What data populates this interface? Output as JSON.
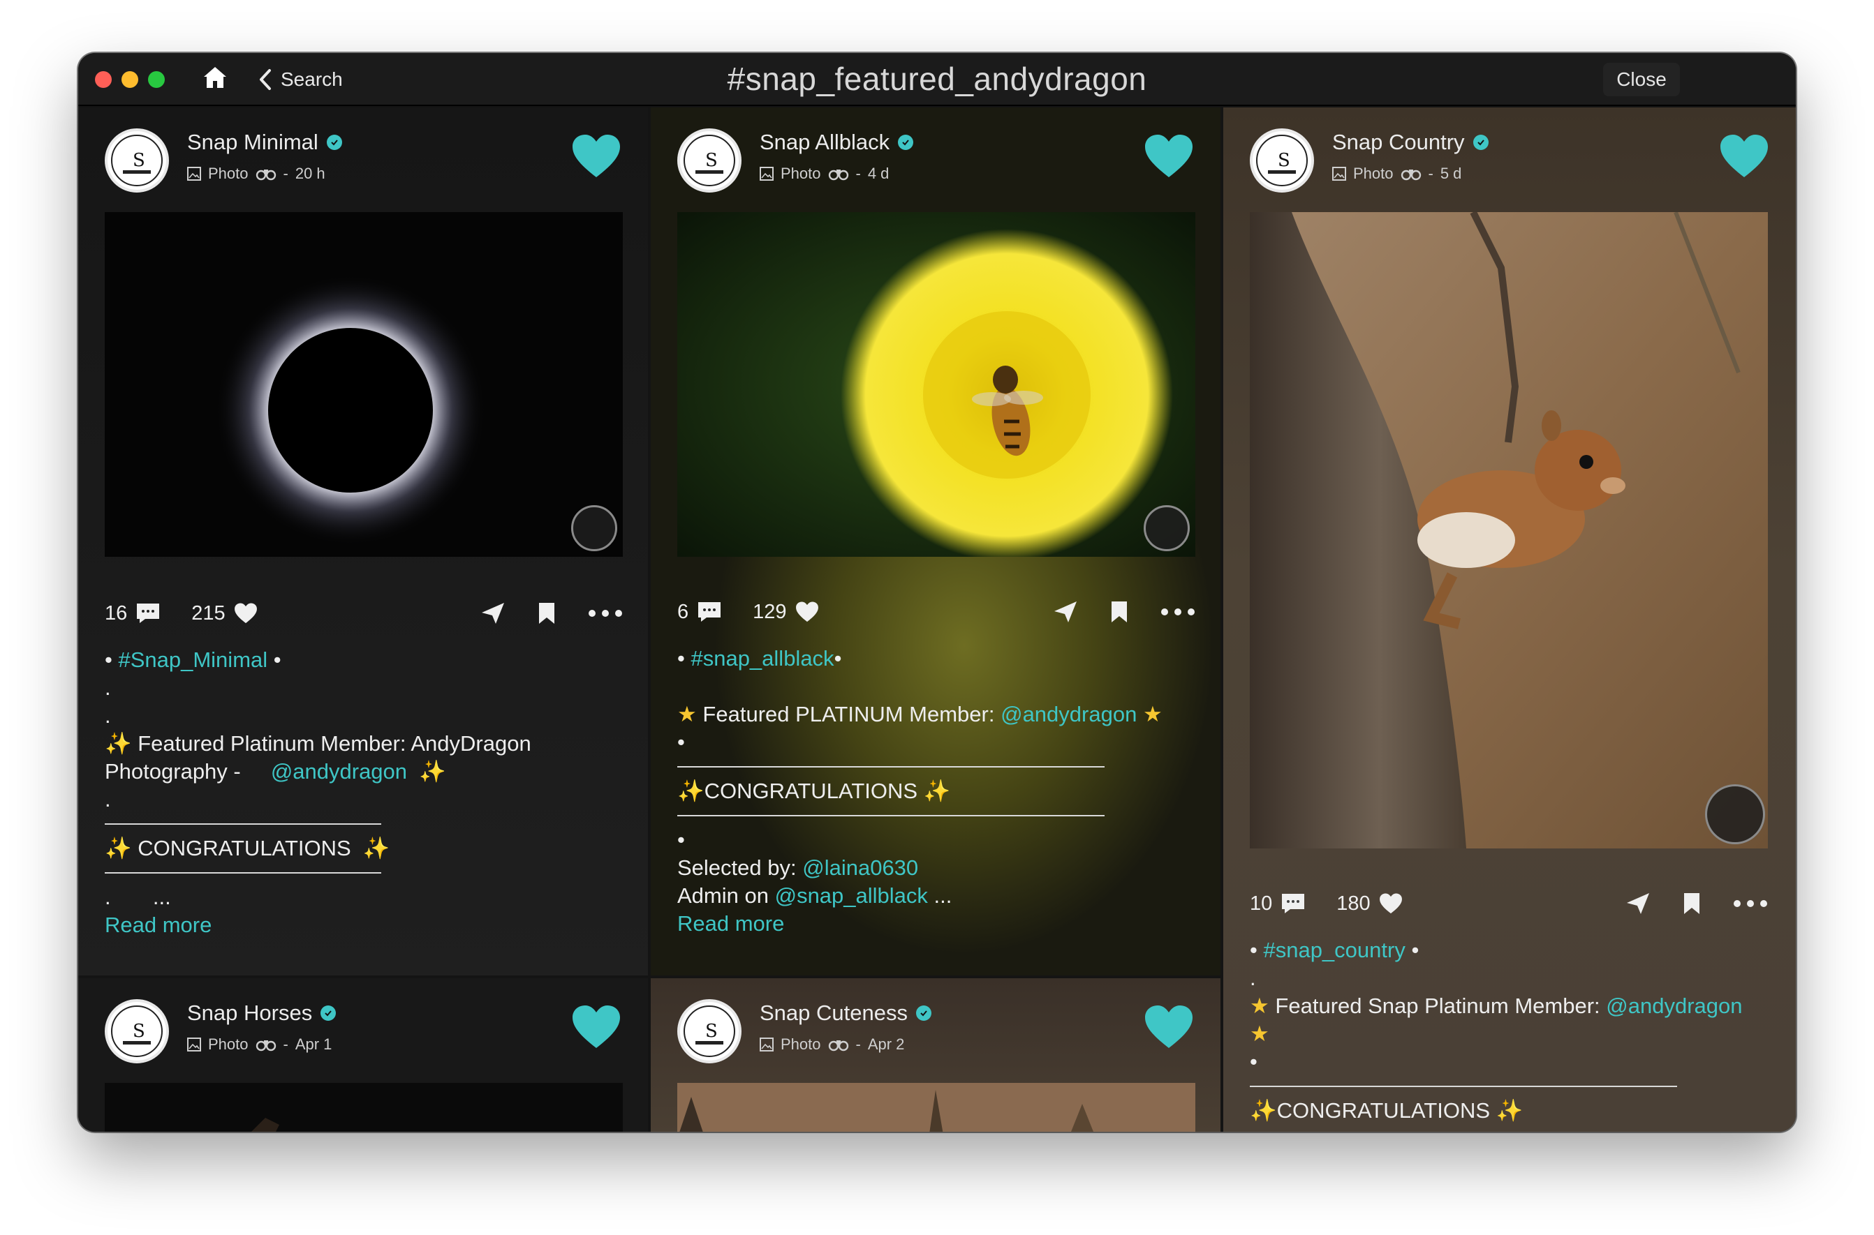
{
  "window": {
    "title": "#snap_featured_andydragon",
    "back_label": "Search",
    "close_label": "Close"
  },
  "colors": {
    "accent": "#3fc6c6",
    "background": "#141414"
  },
  "icons": {
    "home": "home-icon",
    "back": "chevron-left-icon",
    "like": "heart-icon",
    "comment": "comment-icon",
    "share": "send-icon",
    "save": "bookmark-icon",
    "more": "more-icon",
    "verified": "verified-badge-icon"
  },
  "posts": [
    {
      "author": "Snap Minimal",
      "type": "Photo",
      "time": "20 h",
      "comments": "16",
      "likes": "215",
      "caption": {
        "tag": "#Snap_Minimal",
        "featured_prefix": "Featured Platinum Member:  AndyDragon",
        "featured_line2": "Photography -",
        "handle": "@andydragon",
        "congrats": "CONGRATULATIONS",
        "ellipsis": "...",
        "read_more": "Read more"
      }
    },
    {
      "author": "Snap Allblack",
      "type": "Photo",
      "time": "4 d",
      "comments": "6",
      "likes": "129",
      "caption": {
        "tag": "#snap_allblack",
        "featured_prefix": "Featured PLATINUM Member:",
        "handle": "@andydragon",
        "congrats": "CONGRATULATIONS",
        "selected_by_label": "Selected by:",
        "selected_by": "@laina0630",
        "admin_label": "Admin on",
        "admin_of": "@snap_allblack",
        "ellipsis": "...",
        "read_more": "Read more"
      }
    },
    {
      "author": "Snap Country",
      "type": "Photo",
      "time": "5 d",
      "comments": "10",
      "likes": "180",
      "caption": {
        "tag": "#snap_country",
        "featured_prefix": "Featured Snap Platinum Member:",
        "handle": "@andydragon",
        "congrats": "CONGRATULATIONS"
      }
    },
    {
      "author": "Snap Horses",
      "type": "Photo",
      "time": "Apr 1"
    },
    {
      "author": "Snap Cuteness",
      "type": "Photo",
      "time": "Apr 2"
    }
  ]
}
